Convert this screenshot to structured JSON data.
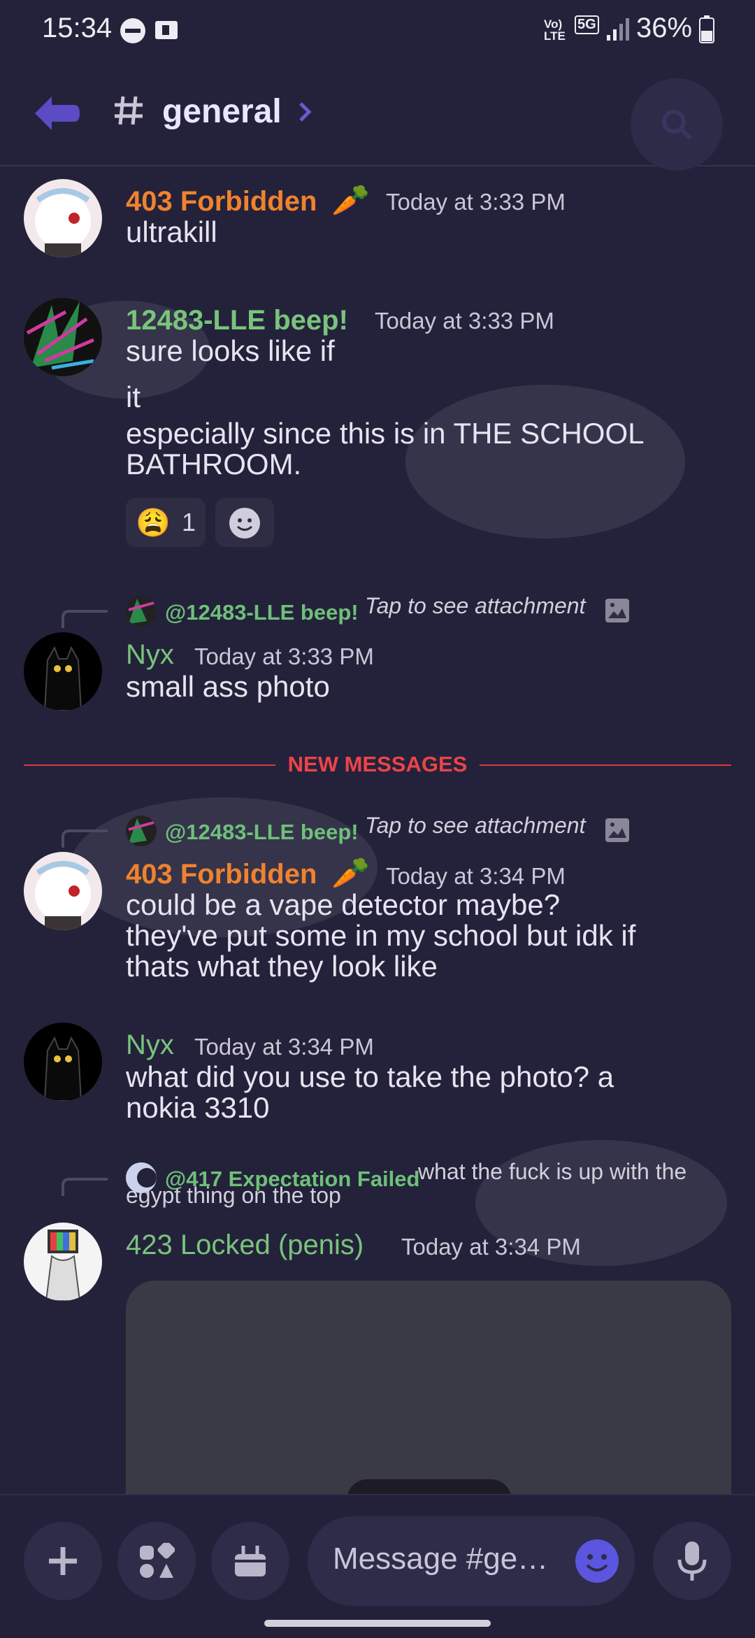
{
  "status_bar": {
    "time": "15:34",
    "battery": "36%",
    "network": "5G",
    "volte": "Vo) LTE"
  },
  "header": {
    "channel": "general"
  },
  "messages": [
    {
      "author": "403 Forbidden",
      "author_color": "#f0822f",
      "badge": "🥕",
      "time": "Today at 3:33 PM",
      "lines": [
        "ultrakill"
      ]
    },
    {
      "author": "12483-LLE beep!",
      "author_color": "#79c47d",
      "time": "Today at 3:33 PM",
      "lines": [
        "sure looks like if",
        "it",
        "especially since this is in THE SCHOOL",
        "BATHROOM."
      ],
      "reactions": [
        {
          "emoji": "😩",
          "count": "1"
        },
        {
          "emoji": "add-reaction"
        }
      ]
    },
    {
      "reply_to": "@12483-LLE beep!",
      "reply_text": "Tap to see attachment",
      "author": "Nyx",
      "author_color": "#79c47d",
      "time": "Today at 3:33 PM",
      "lines": [
        "small ass photo"
      ]
    },
    {
      "reply_to": "@12483-LLE beep!",
      "reply_text": "Tap to see attachment",
      "author": "403 Forbidden",
      "author_color": "#f0822f",
      "badge": "🥕",
      "time": "Today at 3:34 PM",
      "lines": [
        "could be a vape detector maybe?",
        "they've put some in my school but idk if",
        "thats what they look like"
      ]
    },
    {
      "author": "Nyx",
      "author_color": "#79c47d",
      "time": "Today at 3:34 PM",
      "lines": [
        "what did you use to take the photo? a",
        "nokia 3310"
      ]
    },
    {
      "reply_to": "@417 Expectation Failed",
      "reply_text": "what the fuck is up with the egypt thing on the top",
      "author": "423 Locked (penis)",
      "author_color": "#79c47d",
      "time": "Today at 3:34 PM",
      "lines": []
    }
  ],
  "divider": {
    "label": "NEW MESSAGES"
  },
  "composer": {
    "placeholder": "Message #ge…"
  },
  "colors": {
    "background": "#24223a",
    "accent": "#5865f2",
    "new_messages": "#ec4349"
  }
}
